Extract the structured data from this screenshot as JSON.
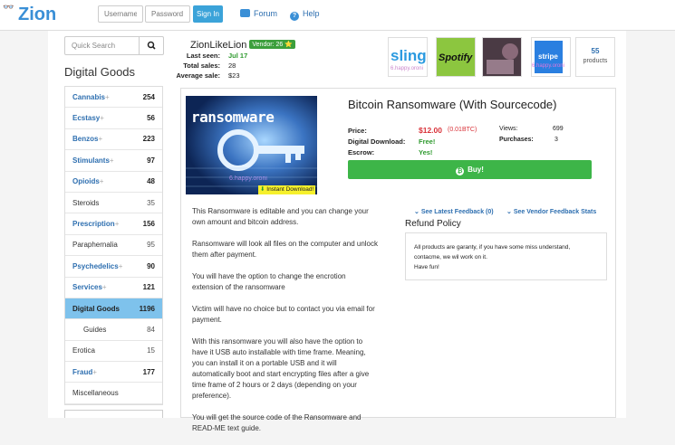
{
  "header": {
    "logo": "Zion",
    "logo_mask": "👓",
    "username_placeholder": "Username",
    "password_placeholder": "Password",
    "signin_label": "Sign In",
    "forum_label": "Forum",
    "help_label": "Help"
  },
  "sidebar": {
    "search_placeholder": "Quick Search",
    "title": "Digital Goods",
    "categories": [
      {
        "label": "Cannabis",
        "count": "254",
        "expandable": true
      },
      {
        "label": "Ecstasy",
        "count": "56",
        "expandable": true
      },
      {
        "label": "Benzos",
        "count": "223",
        "expandable": true
      },
      {
        "label": "Stimulants",
        "count": "97",
        "expandable": true
      },
      {
        "label": "Opioids",
        "count": "48",
        "expandable": true
      },
      {
        "label": "Steroids",
        "count": "35",
        "expandable": false
      },
      {
        "label": "Prescription",
        "count": "156",
        "expandable": true
      },
      {
        "label": "Paraphernalia",
        "count": "95",
        "expandable": false
      },
      {
        "label": "Psychedelics",
        "count": "90",
        "expandable": true
      },
      {
        "label": "Services",
        "count": "121",
        "expandable": true
      },
      {
        "label": "Digital Goods",
        "count": "1196",
        "expandable": false
      },
      {
        "label": "Guides",
        "count": "84",
        "expandable": false
      },
      {
        "label": "Erotica",
        "count": "15",
        "expandable": false
      },
      {
        "label": "Fraud",
        "count": "177",
        "expandable": true
      },
      {
        "label": "Miscellaneous",
        "count": "",
        "expandable": false
      }
    ],
    "plus_glyph": "+"
  },
  "vendor": {
    "name": "ZionLikeLion",
    "badge": "Vendor: 26 ⭐",
    "last_seen_label": "Last seen:",
    "last_seen": "Jul 17",
    "total_sales_label": "Total sales:",
    "total_sales": "28",
    "avg_sale_label": "Average sale:",
    "avg_sale": "$23",
    "logos": [
      {
        "text": "sling",
        "sub": "6.happy.oroni"
      },
      {
        "text": "Spotify",
        "sub": ""
      },
      {
        "text": "",
        "sub": ""
      },
      {
        "text": "stripe",
        "sub": "6.happy.oroni"
      }
    ],
    "product_count": "55",
    "product_label": "products"
  },
  "product": {
    "image_text": "ransomware",
    "image_watermark": "6.happy.oroni",
    "instant_label": "Instant Download!",
    "title": "Bitcoin Ransomware (With Sourcecode)",
    "price_label": "Price:",
    "price": "$12.00",
    "price_btc": "(0.01BTC)",
    "digital_label": "Digital Download:",
    "digital_value": "Free!",
    "escrow_label": "Escrow:",
    "escrow_value": "Yes!",
    "views_label": "Views:",
    "views": "699",
    "purchases_label": "Purchases:",
    "purchases": "3",
    "buy_label": "Buy!",
    "description": [
      "This Ransomware is editable and you can change your own amount and bitcoin address.",
      "Ransomware will look all files on the computer and unlock them after payment.",
      "You will have the option to change the encrotion extension of the ransomware",
      "Victim will have no choice but to contact you via email for payment.",
      "With this ransomware you will also have the option to have it USB auto installable with time frame. Meaning, you can install it on a portable USB and it will automatically boot and start encrypting files after a give time frame of 2 hours or 2 days (depending on your preference).",
      "You will get the source code of the Ransomware and READ-ME text guide."
    ],
    "latest_feedback": "See Latest Feedback (0)",
    "vendor_feedback": "See Vendor Feedback Stats",
    "refund_title": "Refund Policy",
    "refund_text": [
      "All products are garanty, if you have some miss understand, contacme, we wil work on it.",
      "Have fun!"
    ]
  },
  "colors": {
    "accent": "#3ba3d9",
    "link": "#2e6fb0",
    "buy": "#3db548",
    "price": "#d9333a",
    "green_text": "#2e9a2e",
    "active_cat": "#7ec2ec"
  }
}
